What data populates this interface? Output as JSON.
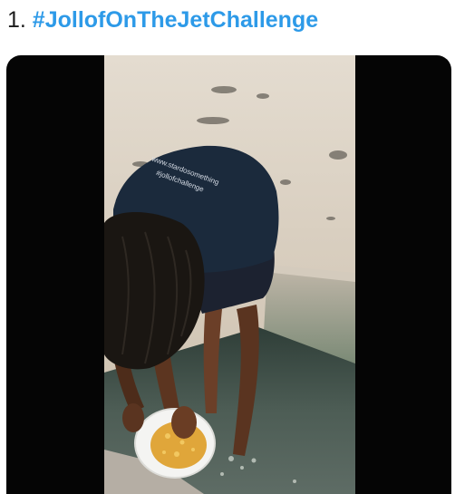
{
  "heading": {
    "number": "1. ",
    "hashtag": "#JollofOnTheJetChallenge"
  },
  "shirt_text": {
    "line1": "www.stardosomething",
    "line2": "#jollofchallenge"
  },
  "colors": {
    "hashtag": "#2d9ae8",
    "letterbox": "#050505",
    "sand": "#d7ccbd",
    "water": "#41504a",
    "shirt": "#1b2a3c"
  }
}
